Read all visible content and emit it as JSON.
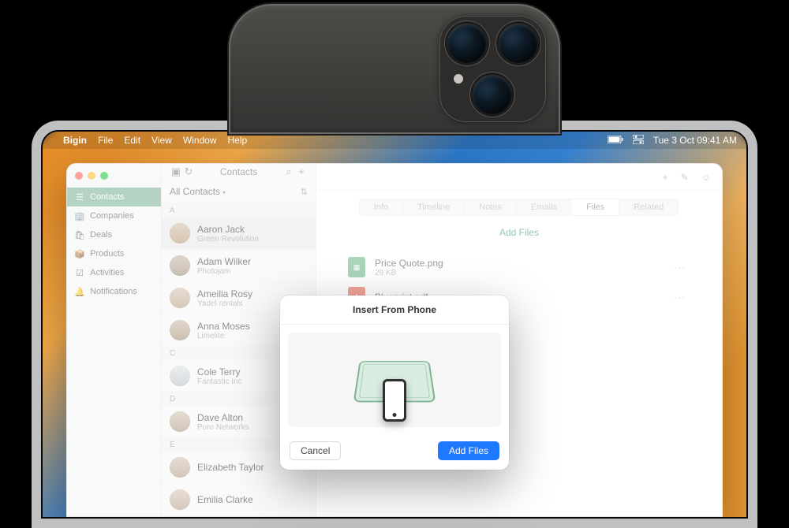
{
  "menubar": {
    "app": "Bigin",
    "items": [
      "File",
      "Edit",
      "View",
      "Window",
      "Help"
    ],
    "datetime": "Tue 3 Oct 09:41 AM"
  },
  "sidebar": {
    "items": [
      {
        "icon": "person-icon",
        "label": "Contacts",
        "active": true
      },
      {
        "icon": "building-icon",
        "label": "Companies"
      },
      {
        "icon": "bag-icon",
        "label": "Deals"
      },
      {
        "icon": "box-icon",
        "label": "Products"
      },
      {
        "icon": "check-icon",
        "label": "Activities"
      },
      {
        "icon": "bell-icon",
        "label": "Notifications"
      }
    ]
  },
  "list": {
    "title": "Contacts",
    "filter": "All Contacts",
    "sections": {
      "A": [
        {
          "name": "Aaron Jack",
          "sub": "Green Revolution",
          "selected": true
        },
        {
          "name": "Adam Wilker",
          "sub": "Photojam"
        },
        {
          "name": "Ameilia Rosy",
          "sub": "Yadel rentals"
        },
        {
          "name": "Anna Moses",
          "sub": "Limelite"
        }
      ],
      "C": [
        {
          "name": "Cole Terry",
          "sub": "Fantastic Inc"
        }
      ],
      "D": [
        {
          "name": "Dave Alton",
          "sub": "Puro Networks"
        }
      ],
      "E": [
        {
          "name": "Elizabeth Taylor",
          "sub": ""
        },
        {
          "name": "Emilia Clarke",
          "sub": ""
        }
      ]
    }
  },
  "detail": {
    "tabs": [
      "Info",
      "Timeline",
      "Notes",
      "Emails",
      "Files",
      "Related"
    ],
    "active_tab": "Files",
    "add_files": "Add Files",
    "files": [
      {
        "name": "Price Quote.png",
        "size": "29 KB",
        "type": "img"
      },
      {
        "name": "Blueprint.pdf",
        "size": "",
        "type": "pdf"
      }
    ]
  },
  "modal": {
    "title": "Insert From Phone",
    "cancel": "Cancel",
    "confirm": "Add Files"
  }
}
